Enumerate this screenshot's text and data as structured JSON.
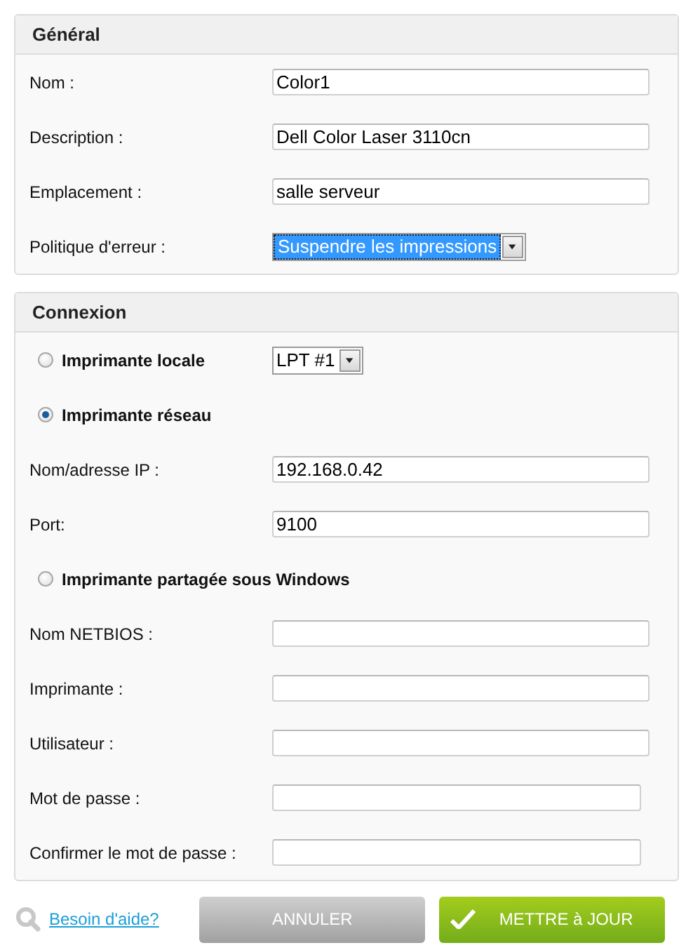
{
  "general": {
    "title": "Général",
    "fields": [
      {
        "kind": "text",
        "label": "Nom :",
        "value": "Color1"
      },
      {
        "kind": "text",
        "label": "Description :",
        "value": "Dell Color Laser 3110cn"
      },
      {
        "kind": "text",
        "label": "Emplacement :",
        "value": "salle serveur"
      },
      {
        "kind": "select",
        "label": "Politique d'erreur :",
        "value": "Suspendre les impressions",
        "highlighted": true
      }
    ]
  },
  "connection": {
    "title": "Connexion",
    "items": [
      {
        "kind": "radio",
        "label": "Imprimante locale",
        "selected": false,
        "select": "LPT #1"
      },
      {
        "kind": "radio",
        "label": "Imprimante réseau",
        "selected": true
      },
      {
        "kind": "text",
        "label": "Nom/adresse IP :",
        "value": "192.168.0.42"
      },
      {
        "kind": "text",
        "label": "Port:",
        "value": "9100"
      },
      {
        "kind": "radio",
        "label": "Imprimante partagée sous Windows",
        "selected": false
      },
      {
        "kind": "text",
        "label": "Nom NETBIOS :"
      },
      {
        "kind": "text",
        "label": "Imprimante :"
      },
      {
        "kind": "text",
        "label": "Utilisateur :"
      },
      {
        "kind": "password",
        "label": "Mot de passe :"
      },
      {
        "kind": "password",
        "label": "Confirmer le mot de passe :"
      }
    ]
  },
  "footer": {
    "help_link": "Besoin d'aide?",
    "cancel": "ANNULER",
    "submit": "METTRE à JOUR"
  }
}
